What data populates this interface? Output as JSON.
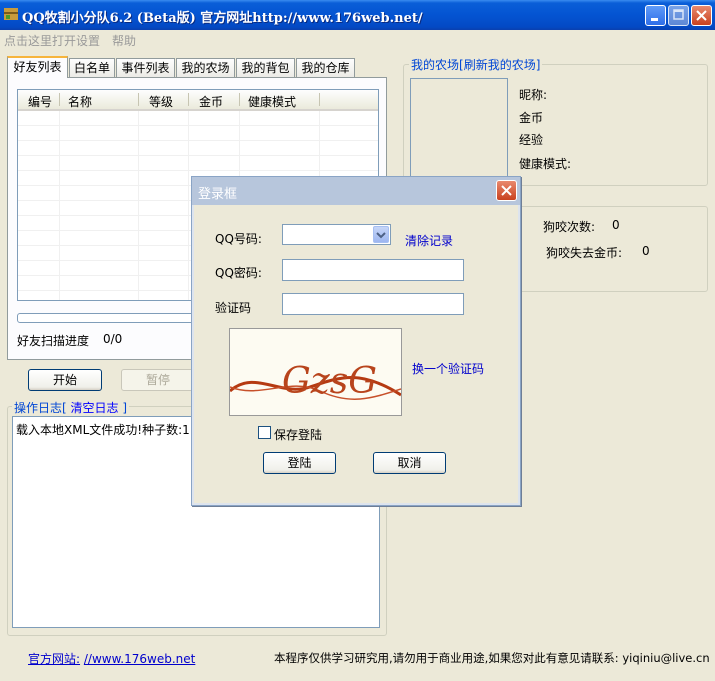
{
  "window": {
    "title": "QQ牧割小分队6.2 (Beta版) 官方网址http://www.176web.net/"
  },
  "menu": {
    "items": [
      "点击这里打开设置",
      "帮助"
    ]
  },
  "tabs": [
    "好友列表",
    "白名单",
    "事件列表",
    "我的农场",
    "我的背包",
    "我的仓库"
  ],
  "friend_list": {
    "columns": [
      "编号",
      "名称",
      "等级",
      "金币",
      "健康模式"
    ],
    "scan_label": "好友扫描进度",
    "scan_value": "0/0"
  },
  "controls": {
    "start": "开始",
    "pause": "暂停"
  },
  "log": {
    "title": "操作日志[",
    "clear_link": "清空日志",
    "title_end": "]",
    "content": "载入本地XML文件成功!种子数:1"
  },
  "farm": {
    "title": "我的农场[",
    "refresh_link": "刷新我的农场",
    "title_end": "]",
    "nickname_label": "昵称:",
    "gold_label": "金币",
    "exp_label": "经验",
    "health_label": "健康模式:"
  },
  "dog": {
    "bite_label": "狗咬次数:",
    "bite_value": "0",
    "lost_label": "狗咬失去金币:",
    "lost_value": "0"
  },
  "login": {
    "title": "登录框",
    "qq_label": "QQ号码:",
    "qq_value": "",
    "clear_record": "清除记录",
    "password_label": "QQ密码:",
    "captcha_label": "验证码",
    "captcha_text": "GzsG",
    "change_captcha": "换一个验证码",
    "save_login": "保存登陆",
    "login_button": "登陆",
    "cancel_button": "取消"
  },
  "footer": {
    "site_label": "官方网站:",
    "site_url": "//www.176web.net",
    "disclaimer": "本程序仅供学习研究用,请勿用于商业用途,如果您对此有意见请联系: yiqiniu@live.cn"
  }
}
